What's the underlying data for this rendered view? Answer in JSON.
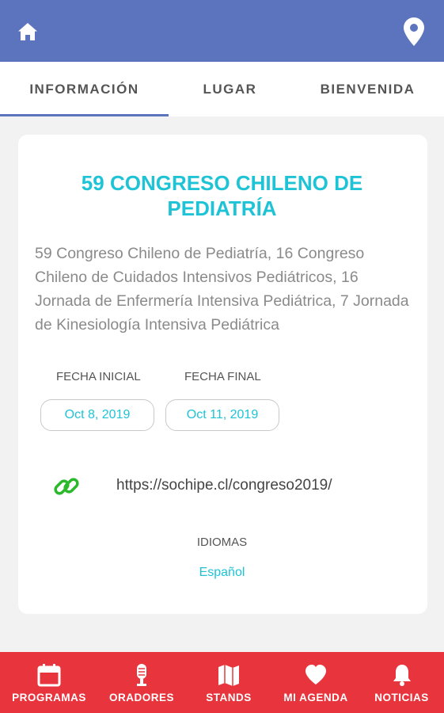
{
  "header": {
    "home_icon": "home-icon",
    "location_icon": "map-pin-icon",
    "bg_color": "#5b74bd"
  },
  "tabs": [
    {
      "label": "INFORMACIÓN",
      "active": true
    },
    {
      "label": "LUGAR",
      "active": false
    },
    {
      "label": "BIENVENIDA",
      "active": false
    }
  ],
  "event": {
    "title": "59 CONGRESO CHILENO DE PEDIATRÍA",
    "description": "59 Congreso Chileno de Pediatría, 16 Congreso Chileno de Cuidados Intensivos Pediátricos, 16 Jornada de Enfermería Intensiva Pediátrica, 7 Jornada de Kinesiología Intensiva Pediátrica",
    "start_label": "FECHA INICIAL",
    "start_date": "Oct 8, 2019",
    "end_label": "FECHA FINAL",
    "end_date": "Oct 11, 2019",
    "url": "https://sochipe.cl/congreso2019/",
    "link_icon": "link-icon",
    "languages_label": "IDIOMAS",
    "languages_value": "Español",
    "accent_color": "#1fc3d6"
  },
  "bottom_nav": {
    "bg_color": "#e8353d",
    "items": [
      {
        "label": "PROGRAMAS",
        "icon": "calendar-icon"
      },
      {
        "label": "ORADORES",
        "icon": "microphone-icon"
      },
      {
        "label": "STANDS",
        "icon": "map-icon"
      },
      {
        "label": "MI AGENDA",
        "icon": "heart-icon"
      },
      {
        "label": "NOTICIAS",
        "icon": "bell-icon"
      }
    ]
  }
}
